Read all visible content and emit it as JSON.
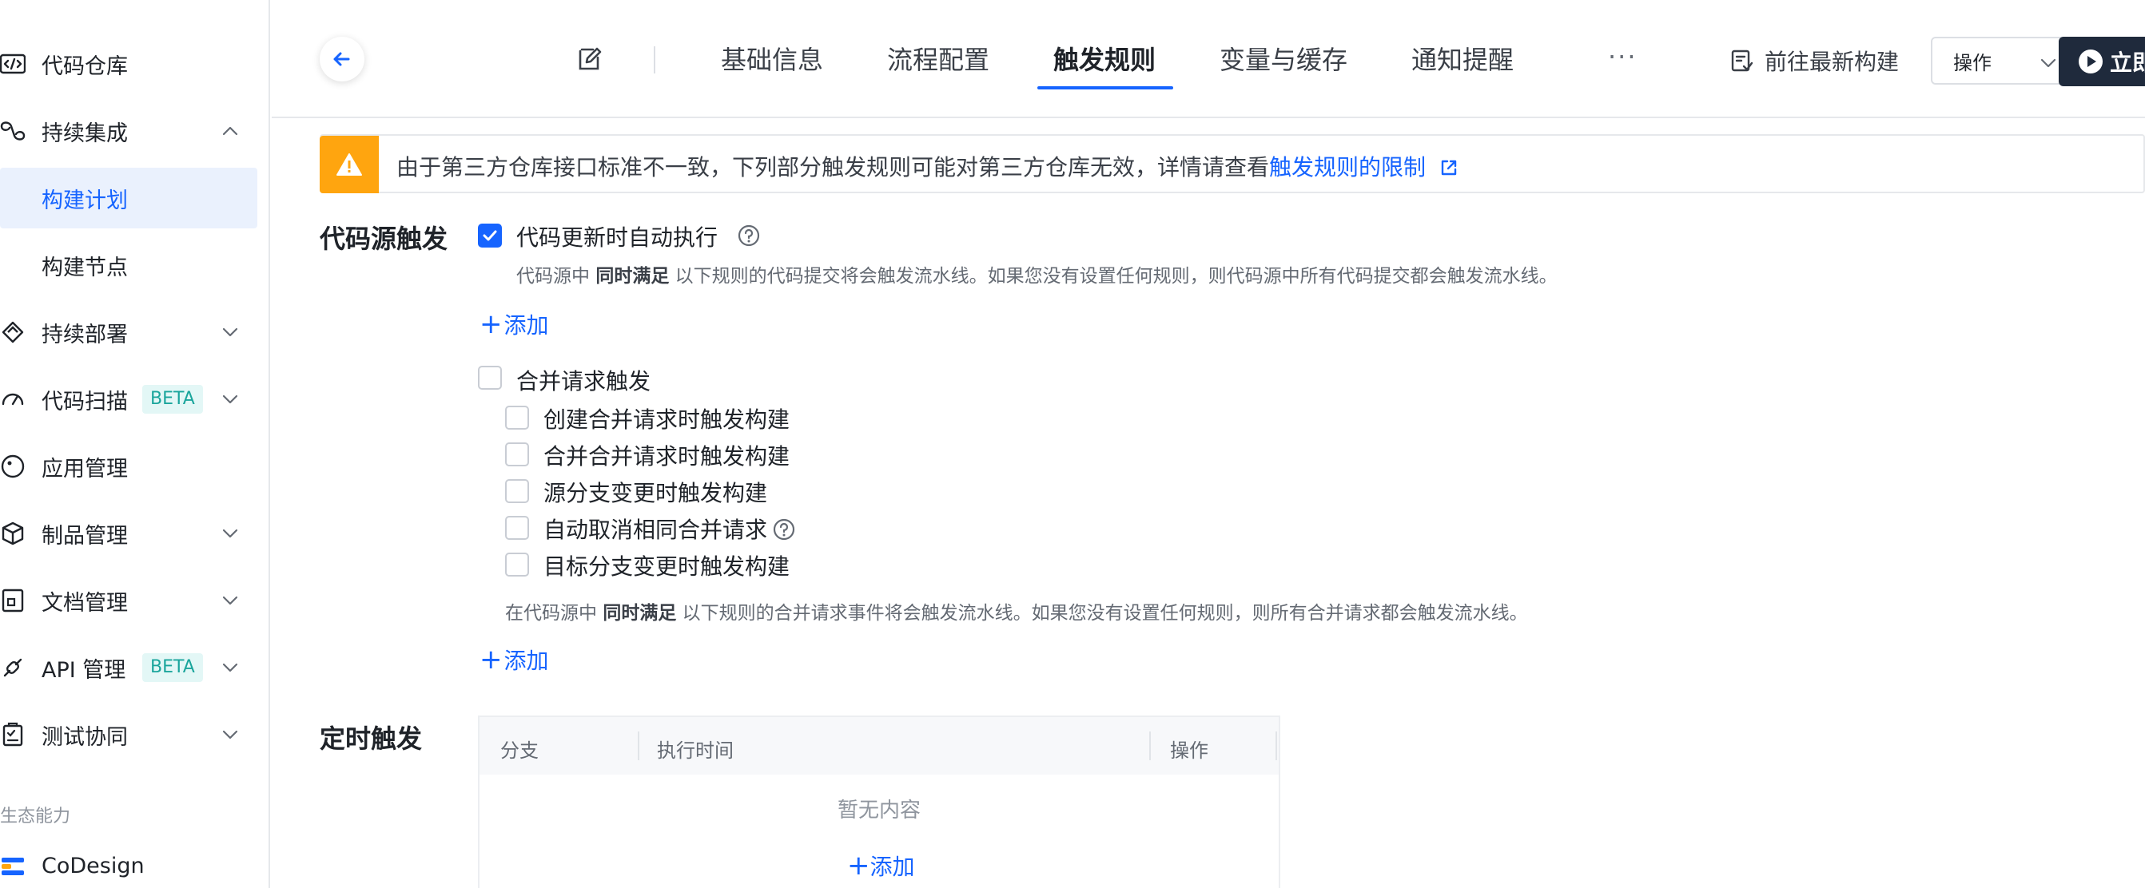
{
  "sidebar": {
    "items": [
      {
        "label": "代码仓库",
        "icon": "code-icon"
      },
      {
        "label": "持续集成",
        "icon": "integration-icon"
      },
      {
        "label": "构建计划"
      },
      {
        "label": "构建节点"
      },
      {
        "label": "持续部署",
        "icon": "deploy-icon"
      },
      {
        "label": "代码扫描",
        "icon": "scan-icon",
        "badge": "BETA"
      },
      {
        "label": "应用管理",
        "icon": "app-icon"
      },
      {
        "label": "制品管理",
        "icon": "package-icon"
      },
      {
        "label": "文档管理",
        "icon": "document-icon"
      },
      {
        "label": "API 管理",
        "icon": "api-icon",
        "badge": "BETA"
      },
      {
        "label": "测试协同",
        "icon": "test-icon"
      }
    ],
    "section_label": "生态能力",
    "codesign_label": "CoDesign"
  },
  "header": {
    "tabs": [
      "基础信息",
      "流程配置",
      "触发规则",
      "变量与缓存",
      "通知提醒"
    ],
    "active_tab": "触发规则",
    "more": "···",
    "goto_latest": "前往最新构建",
    "operations": "操作",
    "run_now": "立即"
  },
  "warning": {
    "text": "由于第三方仓库接口标准不一致，下列部分触发规则可能对第三方仓库无效，详情请查看",
    "link": "触发规则的限制"
  },
  "code_trigger": {
    "title": "代码源触发",
    "auto_run_label": "代码更新时自动执行",
    "auto_run_checked": true,
    "auto_run_desc_pre": "代码源中",
    "auto_run_desc_bold": "同时满足",
    "auto_run_desc_post": "以下规则的代码提交将会触发流水线。如果您没有设置任何规则，则代码源中所有代码提交都会触发流水线。",
    "add_label": "添加",
    "mr_label": "合并请求触发",
    "mr_checked": false,
    "mr_options": [
      "创建合并请求时触发构建",
      "合并合并请求时触发构建",
      "源分支变更时触发构建",
      "自动取消相同合并请求",
      "目标分支变更时触发构建"
    ],
    "mr_desc_pre": "在代码源中",
    "mr_desc_bold": "同时满足",
    "mr_desc_post": "以下规则的合并请求事件将会触发流水线。如果您没有设置任何规则，则所有合并请求都会触发流水线。"
  },
  "timer_trigger": {
    "title": "定时触发",
    "columns": [
      "分支",
      "执行时间",
      "操作"
    ],
    "empty_text": "暂无内容",
    "add_label": "添加"
  },
  "colors": {
    "accent": "#1664ff",
    "warning": "#ffa50f",
    "active_bg": "#eaf1fd",
    "beta_bg": "#e3f7f6",
    "beta_text": "#1aa59c"
  }
}
